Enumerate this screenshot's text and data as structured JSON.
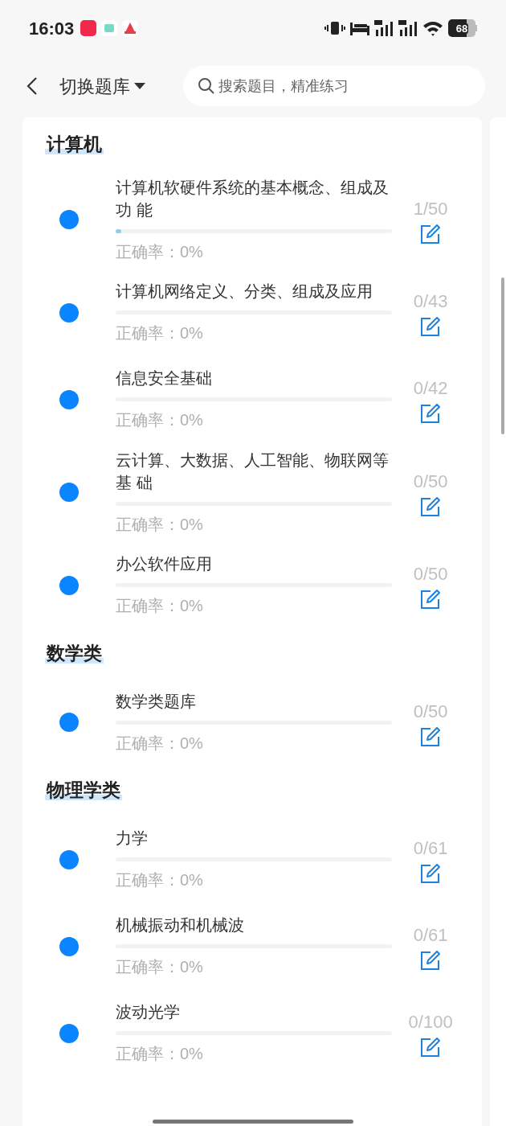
{
  "status_bar": {
    "time": "16:03",
    "battery": "68"
  },
  "nav": {
    "title": "切换题库",
    "search": {
      "placeholder": "搜索题目，精准练习"
    }
  },
  "sections": [
    {
      "title": "计算机",
      "items": [
        {
          "title": "计算机软硬件系统的基本概念、组成及功 能",
          "count": "1/50",
          "level": 0.02,
          "accuracy": "正确率：0%"
        },
        {
          "title": "计算机网络定义、分类、组成及应用",
          "count": "0/43",
          "level": 0,
          "accuracy": "正确率：0%"
        },
        {
          "title": "信息安全基础",
          "count": "0/42",
          "level": 0,
          "accuracy": "正确率：0%"
        },
        {
          "title": "云计算、大数据、人工智能、物联网等基 础",
          "count": "0/50",
          "level": 0,
          "accuracy": "正确率：0%"
        },
        {
          "title": "办公软件应用",
          "count": "0/50",
          "level": 0,
          "accuracy": "正确率：0%"
        }
      ]
    },
    {
      "title": "数学类",
      "items": [
        {
          "title": "数学类题库",
          "count": "0/50",
          "level": 0,
          "accuracy": "正确率：0%"
        }
      ]
    },
    {
      "title": "物理学类",
      "items": [
        {
          "title": "力学",
          "count": "0/61",
          "level": 0,
          "accuracy": "正确率：0%"
        },
        {
          "title": "机械振动和机械波",
          "count": "0/61",
          "level": 0,
          "accuracy": "正确率：0%"
        },
        {
          "title": "波动光学",
          "count": "0/100",
          "level": 0,
          "accuracy": "正确率：0%"
        }
      ]
    }
  ]
}
